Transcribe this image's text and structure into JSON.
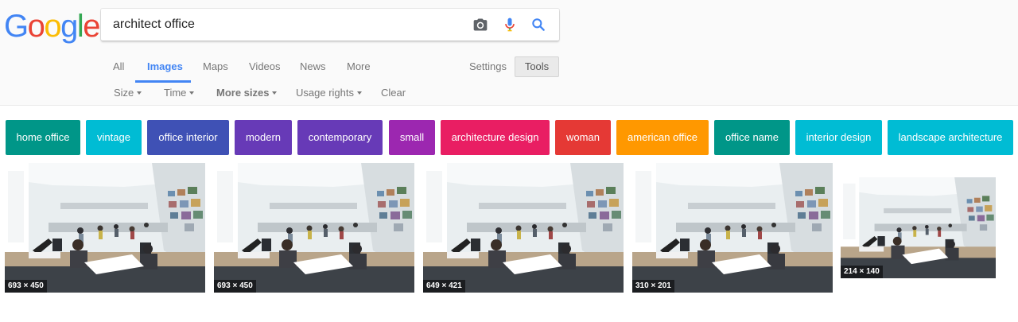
{
  "logo": {
    "letters": [
      "G",
      "o",
      "o",
      "g",
      "l",
      "e"
    ],
    "colors": [
      "#4285f4",
      "#ea4335",
      "#fbbc05",
      "#4285f4",
      "#34a853",
      "#ea4335"
    ]
  },
  "search": {
    "query": "architect office",
    "camera_icon": "camera-icon",
    "mic_icon": "microphone-icon",
    "search_icon": "search-icon"
  },
  "tabs": [
    {
      "label": "All",
      "active": false
    },
    {
      "label": "Images",
      "active": true
    },
    {
      "label": "Maps",
      "active": false
    },
    {
      "label": "Videos",
      "active": false
    },
    {
      "label": "News",
      "active": false
    },
    {
      "label": "More",
      "active": false
    }
  ],
  "settings_label": "Settings",
  "tools_label": "Tools",
  "filters": [
    {
      "label": "Size",
      "has_caret": true
    },
    {
      "label": "Time",
      "has_caret": true
    },
    {
      "label": "More sizes",
      "has_caret": true
    },
    {
      "label": "Usage rights",
      "has_caret": true
    },
    {
      "label": "Clear",
      "has_caret": false
    }
  ],
  "chips": [
    {
      "label": "home office",
      "color": "#009688"
    },
    {
      "label": "vintage",
      "color": "#00bcd4"
    },
    {
      "label": "office interior",
      "color": "#3f51b5"
    },
    {
      "label": "modern",
      "color": "#673ab7"
    },
    {
      "label": "contemporary",
      "color": "#673ab7"
    },
    {
      "label": "small",
      "color": "#9c27b0"
    },
    {
      "label": "architecture design",
      "color": "#e91e63"
    },
    {
      "label": "woman",
      "color": "#e53935"
    },
    {
      "label": "american office",
      "color": "#ff9800"
    },
    {
      "label": "office name",
      "color": "#009688"
    },
    {
      "label": "interior design",
      "color": "#00bcd4"
    },
    {
      "label": "landscape architecture",
      "color": "#00bcd4"
    }
  ],
  "results": [
    {
      "dims": "693 × 450"
    },
    {
      "dims": "693 × 450"
    },
    {
      "dims": "649 × 421"
    },
    {
      "dims": "310 × 201"
    },
    {
      "dims": "214 × 140"
    }
  ]
}
